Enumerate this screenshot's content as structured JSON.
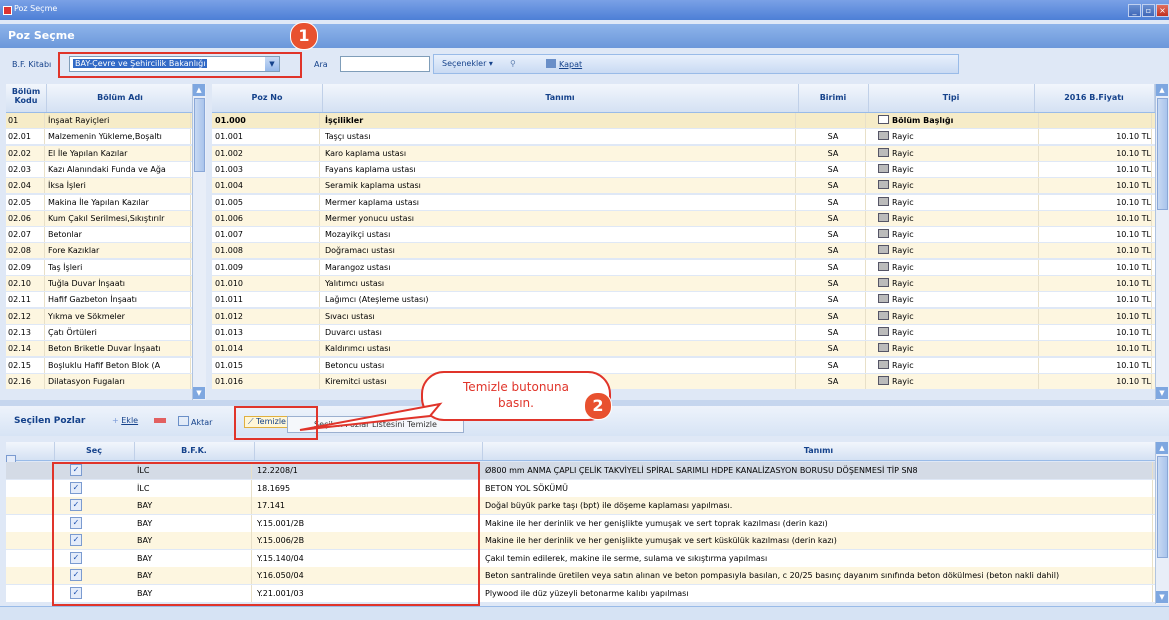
{
  "window": {
    "title": "Poz Seçme",
    "min": "_",
    "max": "▫",
    "close": "×"
  },
  "header": {
    "title": "Poz Seçme"
  },
  "toolbar": {
    "book_label": "B.F. Kitabı",
    "book_value": "BAY-Çevre ve Şehircilik Bakanlığı",
    "search_label": "Ara",
    "search_value": "",
    "options_label": "Seçenekler",
    "close_label": "Kapat"
  },
  "left_grid": {
    "columns": [
      "Bölüm Kodu",
      "Bölüm Adı"
    ],
    "rows": [
      [
        "01",
        "İnşaat Rayiçleri"
      ],
      [
        "02.01",
        "Malzemenin Yükleme,Boşaltı"
      ],
      [
        "02.02",
        "El İle Yapılan Kazılar"
      ],
      [
        "02.03",
        "Kazı Alanındaki Funda ve Ağa"
      ],
      [
        "02.04",
        "İksa İşleri"
      ],
      [
        "02.05",
        "Makina İle Yapılan Kazılar"
      ],
      [
        "02.06",
        "Kum Çakıl Serilmesi,Sıkıştırılr"
      ],
      [
        "02.07",
        "Betonlar"
      ],
      [
        "02.08",
        "Fore Kazıklar"
      ],
      [
        "02.09",
        "Taş İşleri"
      ],
      [
        "02.10",
        "Tuğla Duvar İnşaatı"
      ],
      [
        "02.11",
        "Hafif Gazbeton İnşaatı"
      ],
      [
        "02.12",
        "Yıkma ve Sökmeler"
      ],
      [
        "02.13",
        "Çatı Örtüleri"
      ],
      [
        "02.14",
        "Beton Briketle Duvar İnşaatı"
      ],
      [
        "02.15",
        "Boşluklu Hafif Beton Blok (A"
      ],
      [
        "02.16",
        "Dilatasyon Fugaları"
      ]
    ]
  },
  "right_grid": {
    "columns": [
      "Poz No",
      "Tanımı",
      "Birimi",
      "Tipi",
      "2016 B.Fiyatı"
    ],
    "rows": [
      [
        "01.000",
        "İşçilikler",
        "",
        "Bölüm Başlığı",
        ""
      ],
      [
        "01.001",
        "Taşçı ustası",
        "SA",
        "Rayic",
        "10.10 TL"
      ],
      [
        "01.002",
        "Karo kaplama ustası",
        "SA",
        "Rayic",
        "10.10 TL"
      ],
      [
        "01.003",
        "Fayans kaplama ustası",
        "SA",
        "Rayic",
        "10.10 TL"
      ],
      [
        "01.004",
        "Seramik kaplama ustası",
        "SA",
        "Rayic",
        "10.10 TL"
      ],
      [
        "01.005",
        "Mermer kaplama ustası",
        "SA",
        "Rayic",
        "10.10 TL"
      ],
      [
        "01.006",
        "Mermer yonucu ustası",
        "SA",
        "Rayic",
        "10.10 TL"
      ],
      [
        "01.007",
        "Mozayikçi ustası",
        "SA",
        "Rayic",
        "10.10 TL"
      ],
      [
        "01.008",
        "Doğramacı ustası",
        "SA",
        "Rayic",
        "10.10 TL"
      ],
      [
        "01.009",
        "Marangoz ustası",
        "SA",
        "Rayic",
        "10.10 TL"
      ],
      [
        "01.010",
        "Yalıtımcı ustası",
        "SA",
        "Rayic",
        "10.10 TL"
      ],
      [
        "01.011",
        "Lağımcı (Ateşleme ustası)",
        "SA",
        "Rayic",
        "10.10 TL"
      ],
      [
        "01.012",
        "Sıvacı ustası",
        "SA",
        "Rayic",
        "10.10 TL"
      ],
      [
        "01.013",
        "Duvarcı ustası",
        "SA",
        "Rayic",
        "10.10 TL"
      ],
      [
        "01.014",
        "Kaldırımcı ustası",
        "SA",
        "Rayic",
        "10.10 TL"
      ],
      [
        "01.015",
        "Betoncu ustası",
        "SA",
        "Rayic",
        "10.10 TL"
      ],
      [
        "01.016",
        "Kiremitci ustası",
        "SA",
        "Rayic",
        "10.10 TL"
      ]
    ]
  },
  "selected": {
    "title": "Seçilen Pozlar",
    "add_label": "Ekle",
    "transfer_label": "Aktar",
    "clear_label": "Temizle",
    "tooltip": "Seçilen Pozlar Listesini Temizle",
    "columns": [
      "Seç",
      "B.F.K.",
      "",
      "Tanımı"
    ],
    "rows": [
      [
        "İLC",
        "12.2208/1",
        "Ø800 mm ANMA ÇAPLI ÇELİK TAKVİYELİ SPİRAL SARIMLI HDPE KANALİZASYON BORUSU DÖŞENMESİ TİP SN8"
      ],
      [
        "İLC",
        "18.1695",
        "BETON YOL SÖKÜMÜ"
      ],
      [
        "BAY",
        "17.141",
        "Doğal büyük parke taşı (bpt) ile döşeme kaplaması yapılması."
      ],
      [
        "BAY",
        "Y.15.001/2B",
        "Makine ile her derinlik ve her genişlikte yumuşak ve sert toprak kazılması (derin kazı)"
      ],
      [
        "BAY",
        "Y.15.006/2B",
        "Makine ile her derinlik ve her genişlikte yumuşak ve sert küskülük kazılması (derin kazı)"
      ],
      [
        "BAY",
        "Y.15.140/04",
        "Çakıl temin edilerek, makine ile serme, sulama ve sıkıştırma yapılması"
      ],
      [
        "BAY",
        "Y.16.050/04",
        "Beton santralinde üretilen veya satın alınan ve beton pompasıyla basılan, c 20/25 basınç dayanım sınıfında beton dökülmesi (beton nakli dahil)"
      ],
      [
        "BAY",
        "Y.21.001/03",
        "Plywood ile düz yüzeyli betonarme kalıbı yapılması"
      ]
    ]
  },
  "annotations": {
    "step1": "1",
    "step2": "2",
    "bubble_text_line1": "Temizle butonuna",
    "bubble_text_line2": "basın."
  },
  "colors": {
    "row_odd": "#fdf6e0",
    "row_even": "#ffffff",
    "highlight": "#e0342a"
  }
}
